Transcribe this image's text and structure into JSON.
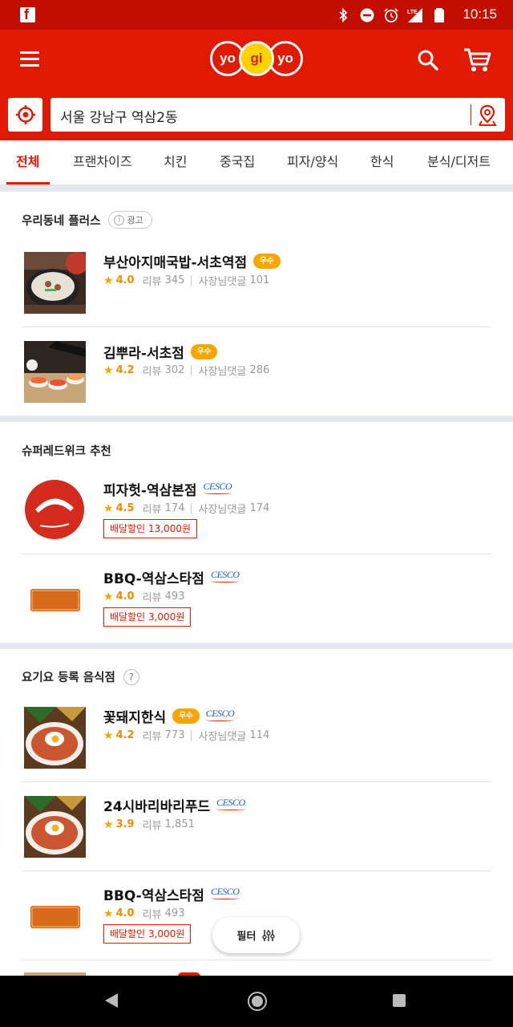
{
  "status_bar": {
    "time": "10:15",
    "icons": [
      "facebook-icon",
      "bluetooth-icon",
      "dnd-icon",
      "alarm-icon",
      "lte-signal-icon",
      "battery-icon"
    ]
  },
  "header": {
    "logo_letters": [
      "yo",
      "gi",
      "yo"
    ]
  },
  "search": {
    "address": "서울 강남구 역삼2동"
  },
  "tabs": [
    "전체",
    "프랜차이즈",
    "치킨",
    "중국집",
    "피자/양식",
    "한식",
    "분식/디저트"
  ],
  "labels": {
    "review": "리뷰",
    "owner_reply": "사장님댓글",
    "good_badge": "우수",
    "cesco": "CESCO",
    "ad": "광고",
    "help": "?"
  },
  "sections": [
    {
      "title": "우리동네 플러스",
      "restaurants": [
        {
          "name": "부산아지매국밥-서초역점",
          "rating": "4.0",
          "reviews": "345",
          "owner_replies": "101"
        },
        {
          "name": "김뿌라-서초점",
          "rating": "4.2",
          "reviews": "302",
          "owner_replies": "286"
        }
      ]
    },
    {
      "title": "슈퍼레드위크 추천",
      "restaurants": [
        {
          "name": "피자헛-역삼본점",
          "rating": "4.5",
          "reviews": "174",
          "owner_replies": "174",
          "discount": "배달할인 13,000원"
        },
        {
          "name": "BBQ-역삼스타점",
          "rating": "4.0",
          "reviews": "493",
          "discount": "배달할인 3,000원"
        }
      ]
    },
    {
      "title": "요기요 등록 음식점",
      "restaurants": [
        {
          "name": "꽃돼지한식",
          "rating": "4.2",
          "reviews": "773",
          "owner_replies": "114"
        },
        {
          "name": "24시바리바리푸드",
          "rating": "3.9",
          "reviews": "1,851"
        },
        {
          "name": "BBQ-역삼스타점",
          "rating": "4.0",
          "reviews": "493",
          "discount": "배달할인 3,000원"
        }
      ]
    }
  ],
  "filter": {
    "label": "필터"
  },
  "colors": {
    "brand_red": "#e01a00",
    "status_red": "#c10e00",
    "badge_orange": "#f7a600",
    "divider_gray": "#e6e9ee"
  }
}
